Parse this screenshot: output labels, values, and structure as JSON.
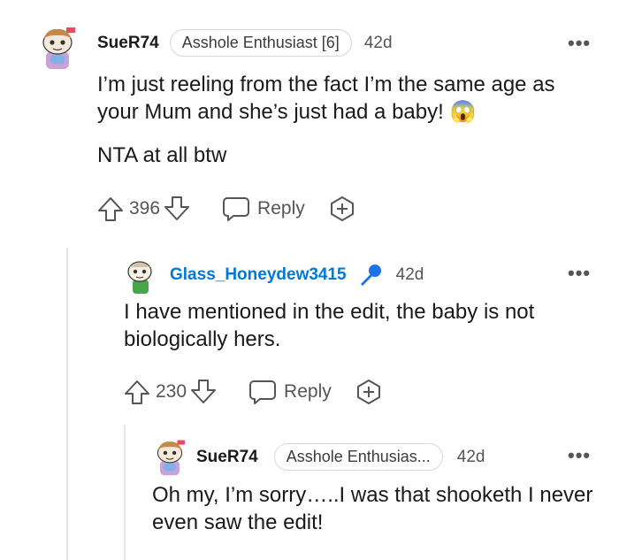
{
  "comments": [
    {
      "username": "SueR74",
      "flair": "Asshole Enthusiast [6]",
      "time": "42d",
      "body": [
        "I’m just reeling from the fact I’m the same age as your Mum and she’s just had a baby! 😱",
        "NTA at all btw"
      ],
      "votes": "396",
      "reply_label": "Reply"
    },
    {
      "username": "Glass_Honeydew3415",
      "time": "42d",
      "body": [
        "I have mentioned in the edit, the baby is not biologically hers."
      ],
      "votes": "230",
      "reply_label": "Reply"
    },
    {
      "username": "SueR74",
      "flair": "Asshole Enthusias...",
      "time": "42d",
      "body": [
        "Oh my, I’m sorry…..I was that shooketh I never even saw the edit!"
      ]
    }
  ],
  "more_label": "•••",
  "colors": {
    "op_accent": "#0079d3",
    "mic": "#1a73e8",
    "text": "#1a1a1b",
    "meta": "#555555"
  }
}
